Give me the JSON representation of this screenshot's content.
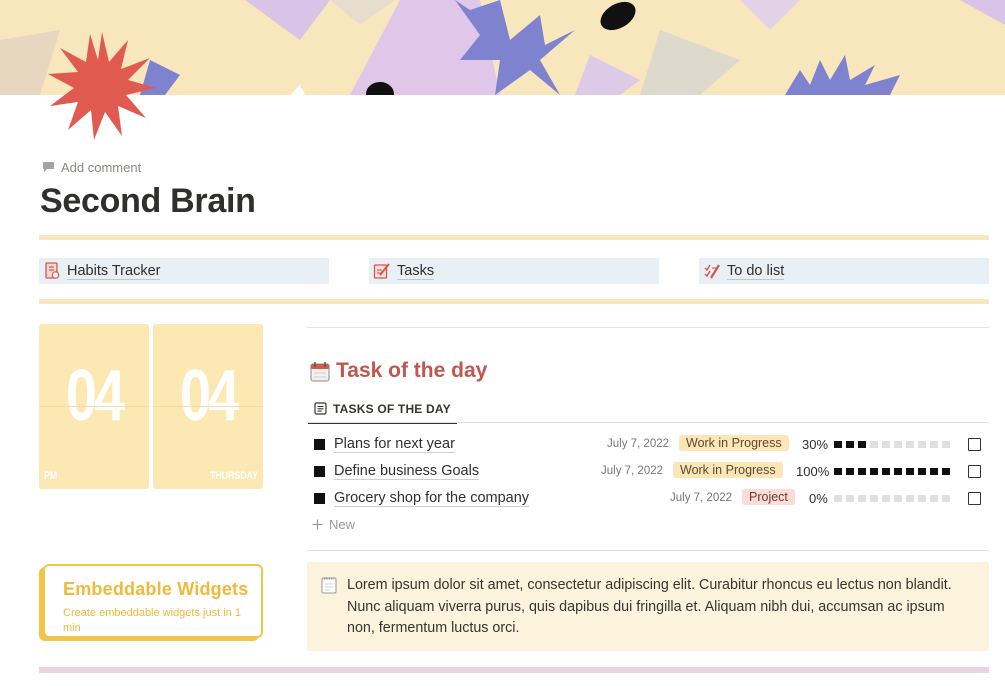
{
  "page": {
    "add_comment_label": "Add comment",
    "title": "Second Brain"
  },
  "links": [
    {
      "label": "Habits Tracker",
      "icon": "ledger-icon"
    },
    {
      "label": "Tasks",
      "icon": "note-pencil-icon"
    },
    {
      "label": "To do list",
      "icon": "pencil-checklist-icon"
    }
  ],
  "clock": {
    "hour": "04",
    "minute": "04",
    "period": "PM",
    "weekday": "THURSDAY"
  },
  "widget": {
    "title": "Embeddable Widgets",
    "subtitle": "Create embeddable widgets just in 1 min"
  },
  "task_section": {
    "title": "Task of the day",
    "tab_label": "TASKS OF THE DAY",
    "new_label": "New",
    "rows": [
      {
        "title": "Plans for next year",
        "date": "July 7, 2022",
        "status": "Work in Progress",
        "progress_label": "30%",
        "progress": 0.3
      },
      {
        "title": "Define business Goals",
        "date": "July 7, 2022",
        "status": "Work in Progress",
        "progress_label": "100%",
        "progress": 1.0
      },
      {
        "title": "Grocery shop for the company",
        "date": "July 7, 2022",
        "status": "Project",
        "progress_label": "0%",
        "progress": 0.0
      }
    ]
  },
  "callout": {
    "text": "Lorem ipsum dolor sit amet, consectetur adipiscing elit. Curabitur rhoncus eu lectus non blandit. Nunc aliquam viverra purus, quis dapibus dui fringilla et. Aliquam nibh dui, accumsan ac ipsum non, fermentum luctus orci."
  },
  "colors": {
    "accent_red": "#c4554d",
    "cover_bg": "#f8e6bd",
    "link_bg": "#e8eff5",
    "status_wip_bg": "#fbe6b8",
    "status_project_bg": "#fbdcd6",
    "widget_yellow": "#f0b93a",
    "callout_bg": "#fbf3db"
  }
}
